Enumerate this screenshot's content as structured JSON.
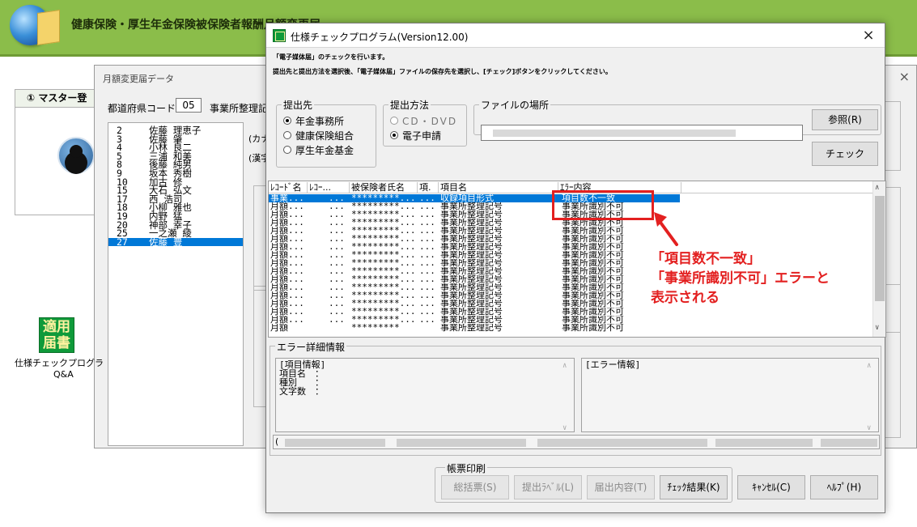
{
  "banner": {
    "title": "健康保険・厚生年金保険被保険者報酬月額変更届"
  },
  "bg_window": {
    "title": "月額変更届データ",
    "close": "×",
    "pref_label": "都道府県コード",
    "pref_code": "05",
    "office_label": "事業所整理記",
    "kana_label": "(カナ",
    "kanji_label": "(漢字"
  },
  "master_panel": {
    "title": "① マスター登"
  },
  "persons": [
    {
      "no": "2",
      "name": "佐藤 理恵子"
    },
    {
      "no": "3",
      "name": "佐藤 肇"
    },
    {
      "no": "4",
      "name": "小林 良二"
    },
    {
      "no": "5",
      "name": "三浦 和美"
    },
    {
      "no": "8",
      "name": "後藤 純男"
    },
    {
      "no": "9",
      "name": "坂本 秀樹"
    },
    {
      "no": "10",
      "name": "加古 修"
    },
    {
      "no": "15",
      "name": "大石 弘文"
    },
    {
      "no": "17",
      "name": "西 浩司"
    },
    {
      "no": "18",
      "name": "小柳 雅也"
    },
    {
      "no": "19",
      "name": "内野 猛"
    },
    {
      "no": "20",
      "name": "神部 幸子"
    },
    {
      "no": "25",
      "name": "一之瀬 綾"
    },
    {
      "no": "27",
      "name": "佐藤 豊"
    }
  ],
  "desktop_icon": {
    "glyph1": "適用",
    "glyph2": "届書",
    "label": "仕様チェックプログラ",
    "label2": "Q&A"
  },
  "dialog": {
    "title": "仕様チェックプログラム(Version12.00)",
    "close": "×",
    "instruction1": "「電子媒体届」のチェックを行います。",
    "instruction2": "提出先と提出方法を選択後、「電子媒体届」ファイルの保存先を選択し、[チェック]ボタンをクリックしてください。",
    "submit_to": {
      "legend": "提出先",
      "options": [
        "年金事務所",
        "健康保険組合",
        "厚生年金基金"
      ]
    },
    "submit_method": {
      "legend": "提出方法",
      "options": [
        "CD・DVD",
        "電子申請"
      ]
    },
    "file": {
      "legend": "ファイルの場所",
      "value": ""
    },
    "browse_label": "参照(R)",
    "check_label": "チェック",
    "columns": [
      "ﾚｺｰﾄﾞ名",
      "ﾚｺｰ...",
      "被保険者氏名",
      "項.",
      "項目名",
      "ｴﾗｰ内容"
    ],
    "records": [
      {
        "rec": "事業...",
        "code": "...",
        "ins": "*********...",
        "item": "...",
        "iname": "収録項目形式",
        "err": "項目数不一致"
      },
      {
        "rec": "月額...",
        "code": "...",
        "ins": "*********...",
        "item": "...",
        "iname": "事業所整理記号",
        "err": "事業所識別不可"
      },
      {
        "rec": "月額...",
        "code": "...",
        "ins": "*********...",
        "item": "...",
        "iname": "事業所整理記号",
        "err": "事業所識別不可"
      },
      {
        "rec": "月額...",
        "code": "...",
        "ins": "*********...",
        "item": "...",
        "iname": "事業所整理記号",
        "err": "事業所識別不可"
      },
      {
        "rec": "月額...",
        "code": "...",
        "ins": "*********...",
        "item": "...",
        "iname": "事業所整理記号",
        "err": "事業所識別不可"
      },
      {
        "rec": "月額...",
        "code": "...",
        "ins": "*********...",
        "item": "...",
        "iname": "事業所整理記号",
        "err": "事業所識別不可"
      },
      {
        "rec": "月額...",
        "code": "...",
        "ins": "*********...",
        "item": "...",
        "iname": "事業所整理記号",
        "err": "事業所識別不可"
      },
      {
        "rec": "月額...",
        "code": "...",
        "ins": "*********...",
        "item": "...",
        "iname": "事業所整理記号",
        "err": "事業所識別不可"
      },
      {
        "rec": "月額...",
        "code": "...",
        "ins": "*********...",
        "item": "...",
        "iname": "事業所整理記号",
        "err": "事業所識別不可"
      },
      {
        "rec": "月額...",
        "code": "...",
        "ins": "*********...",
        "item": "...",
        "iname": "事業所整理記号",
        "err": "事業所識別不可"
      },
      {
        "rec": "月額...",
        "code": "...",
        "ins": "*********...",
        "item": "...",
        "iname": "事業所整理記号",
        "err": "事業所識別不可"
      },
      {
        "rec": "月額...",
        "code": "...",
        "ins": "*********...",
        "item": "...",
        "iname": "事業所整理記号",
        "err": "事業所識別不可"
      },
      {
        "rec": "月額...",
        "code": "...",
        "ins": "*********...",
        "item": "...",
        "iname": "事業所整理記号",
        "err": "事業所識別不可"
      },
      {
        "rec": "月額...",
        "code": "...",
        "ins": "*********...",
        "item": "...",
        "iname": "事業所整理記号",
        "err": "事業所識別不可"
      },
      {
        "rec": "月額...",
        "code": "...",
        "ins": "*********...",
        "item": "...",
        "iname": "事業所整理記号",
        "err": "事業所識別不可"
      },
      {
        "rec": "月額...",
        "code": "...",
        "ins": "*********...",
        "item": "...",
        "iname": "事業所整理記号",
        "err": "事業所識別不可"
      },
      {
        "rec": "月額",
        "code": "",
        "ins": "*********",
        "item": "",
        "iname": "事業所整理記号",
        "err": "事業所識別不可"
      }
    ],
    "error_detail": {
      "legend": "エラー詳細情報",
      "item_info_title": "[項目情報]",
      "item_name_label": "項目名　：",
      "kind_label": "種別　　：",
      "chars_label": "文字数　：",
      "error_info_title": "[エラー情報]"
    },
    "print_group": {
      "legend": "帳票印刷"
    },
    "buttons": {
      "summary": "総括票(S)",
      "label": "提出ﾗﾍﾞﾙ(L)",
      "content": "届出内容(T)",
      "result": "ﾁｪｯｸ結果(K)",
      "cancel": "ｷｬﾝｾﾙ(C)",
      "help": "ﾍﾙﾌﾟ(H)"
    }
  },
  "annotation": {
    "line1": "「項目数不一致」",
    "line2": "「事業所識別不可」エラーと",
    "line3": "表示される"
  },
  "colors": {
    "banner": "#8bbd4a",
    "selection": "#0078d7",
    "annotation": "#e32020"
  }
}
